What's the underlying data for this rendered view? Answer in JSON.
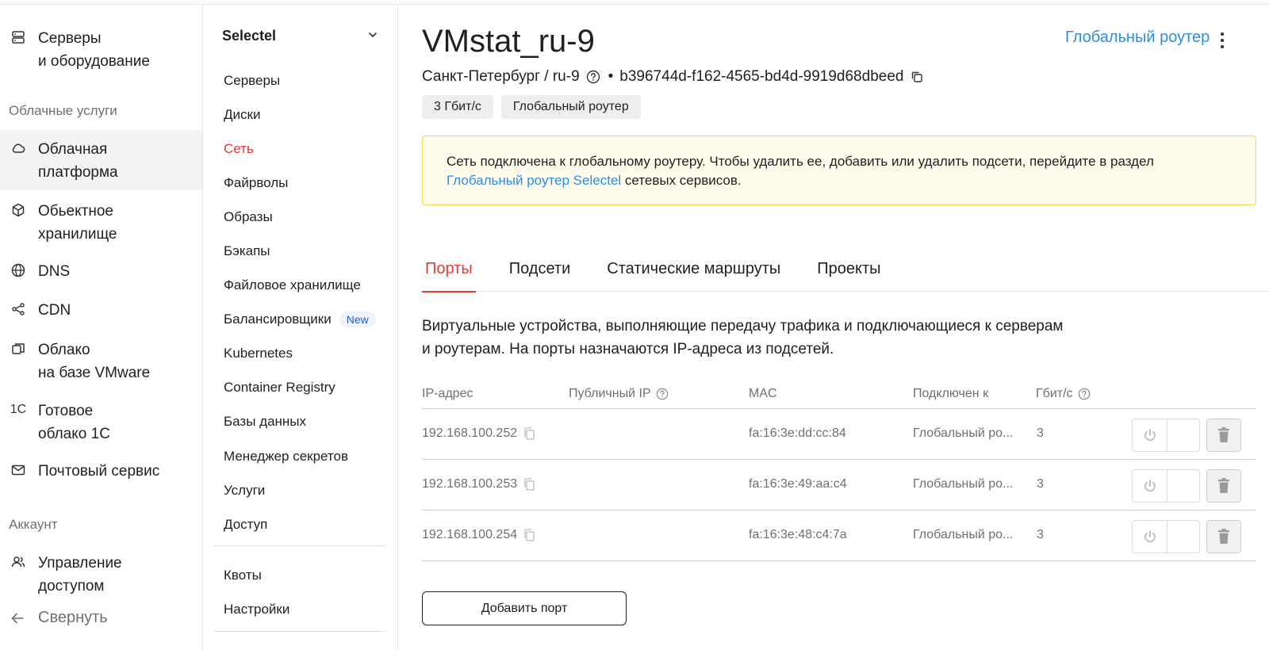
{
  "sidebar": {
    "items_top": [
      {
        "label_line1": "Серверы",
        "label_line2": "и оборудование",
        "icon": "server-icon"
      }
    ],
    "section_cloud": "Облачные услуги",
    "items_cloud": [
      {
        "label_line1": "Облачная",
        "label_line2": "платформа",
        "icon": "cloud-icon"
      },
      {
        "label_line1": "Обьектное",
        "label_line2": "хранилище",
        "icon": "box-icon"
      },
      {
        "label_line1": "DNS",
        "label_line2": "",
        "icon": "globe-icon"
      },
      {
        "label_line1": "CDN",
        "label_line2": "",
        "icon": "cdn-icon"
      },
      {
        "label_line1": "Облако",
        "label_line2": "на базе VMware",
        "icon": "vmware-icon"
      },
      {
        "label_line1": "Готовое",
        "label_line2": "облако 1С",
        "icon": "1c-icon"
      },
      {
        "label_line1": "Почтовый сервис",
        "label_line2": "",
        "icon": "mail-icon"
      }
    ],
    "section_account": "Аккаунт",
    "items_account": [
      {
        "label_line1": "Управление",
        "label_line2": "доступом",
        "icon": "users-icon"
      }
    ],
    "collapse_label": "Свернуть",
    "icon_1c_text": "1С"
  },
  "subnav": {
    "org_name": "Selectel",
    "items": [
      "Серверы",
      "Диски",
      "Сеть",
      "Файрволы",
      "Образы",
      "Бэкапы",
      "Файловое хранилище",
      "Балансировщики",
      "Kubernetes",
      "Container Registry",
      "Базы данных",
      "Менеджер секретов",
      "Услуги",
      "Доступ"
    ],
    "new_badge": "New",
    "items_bottom": [
      "Квоты",
      "Настройки"
    ]
  },
  "main": {
    "title": "VMstat_ru-9",
    "top_link": "Глобальный роутер",
    "location": "Санкт-Петербург / ru-9",
    "dot": "•",
    "network_id": "b396744d-f162-4565-bd4d-9919d68dbeed",
    "tags": [
      "3 Гбит/с",
      "Глобальный роутер"
    ],
    "notice": {
      "text1": "Сеть подключена к глобальному роутеру. Чтобы удалить ее, добавить или удалить подсети, перейдите в раздел",
      "link": "Глобальный роутер Selectel",
      "text2": " сетевых сервисов."
    },
    "tabs": [
      "Порты",
      "Подсети",
      "Статические маршруты",
      "Проекты"
    ],
    "description_line1": "Виртуальные устройства, выполняющие передачу трафика и подключающиеся к серверам",
    "description_line2": "и роутерам. На порты назначаются IP-адреса из подсетей.",
    "table": {
      "headers": {
        "ip": "IP-адрес",
        "public_ip": "Публичный IP",
        "mac": "MAC",
        "connected": "Подключен к",
        "gbit": "Гбит/с"
      },
      "rows": [
        {
          "ip": "192.168.100.252",
          "mac": "fa:16:3e:dd:cc:84",
          "connected": "Глобальный ро...",
          "gbit": "3"
        },
        {
          "ip": "192.168.100.253",
          "mac": "fa:16:3e:49:aa:c4",
          "connected": "Глобальный ро...",
          "gbit": "3"
        },
        {
          "ip": "192.168.100.254",
          "mac": "fa:16:3e:48:c4:7a",
          "connected": "Глобальный ро...",
          "gbit": "3"
        }
      ]
    },
    "add_button": "Добавить порт"
  },
  "colors": {
    "accent_red": "#e53935",
    "link_blue": "#2b8de6",
    "notice_bg": "#fffbea",
    "notice_border": "#f1d85f"
  }
}
